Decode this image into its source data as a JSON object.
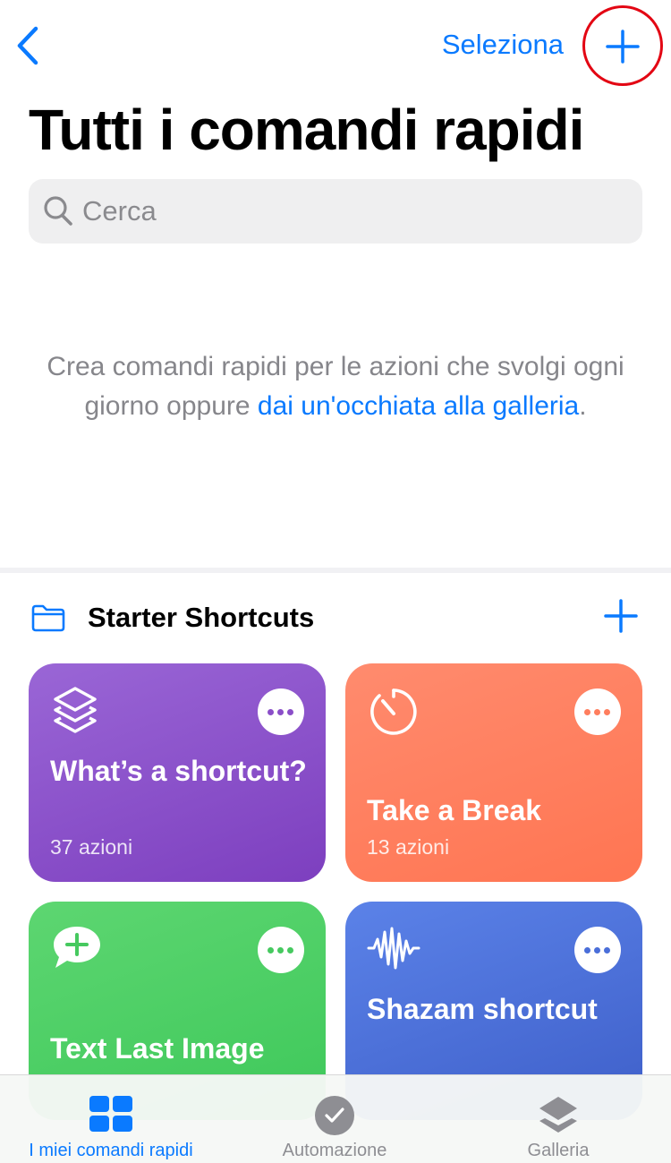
{
  "nav": {
    "select_label": "Seleziona"
  },
  "page": {
    "title": "Tutti i comandi rapidi"
  },
  "search": {
    "placeholder": "Cerca",
    "value": ""
  },
  "empty_state": {
    "text_before": "Crea comandi rapidi per le azioni che svolgi ogni giorno oppure ",
    "link_text": "dai un'occhiata alla galleria",
    "text_after": "."
  },
  "section": {
    "title": "Starter Shortcuts"
  },
  "cards": [
    {
      "title": "What’s a shortcut?",
      "subtitle": "37 azioni",
      "icon": "layers-icon",
      "color": "#8a4ec8"
    },
    {
      "title": "Take a Break",
      "subtitle": "13 azioni",
      "icon": "timer-icon",
      "color": "#ff7e5e"
    },
    {
      "title": "Text Last Image",
      "subtitle": "",
      "icon": "message-plus-icon",
      "color": "#46c95f"
    },
    {
      "title": "Shazam shortcut",
      "subtitle": "",
      "icon": "waveform-icon",
      "color": "#4a6ed9"
    }
  ],
  "tabs": [
    {
      "label": "I miei comandi rapidi",
      "selected": true
    },
    {
      "label": "Automazione",
      "selected": false
    },
    {
      "label": "Galleria",
      "selected": false
    }
  ],
  "colors": {
    "accent": "#0a7aff",
    "annotation_ring": "#e30613"
  }
}
